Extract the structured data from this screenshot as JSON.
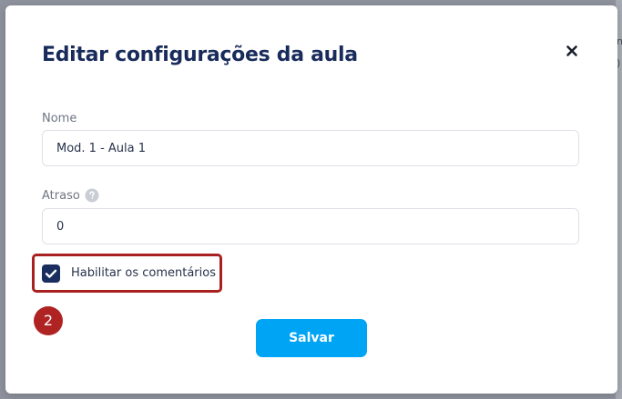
{
  "modal": {
    "title": "Editar configurações da aula",
    "close_icon": "close-icon"
  },
  "fields": {
    "nome": {
      "label": "Nome",
      "value": "Mod. 1 - Aula 1"
    },
    "atraso": {
      "label": "Atraso",
      "value": "0",
      "help_icon": "question-circle-icon"
    }
  },
  "comments": {
    "label": "Habilitar os comentários",
    "checked": true
  },
  "annotation": {
    "step": "2",
    "highlight_color": "#a8201f",
    "badge_color": "#b02323"
  },
  "actions": {
    "save_label": "Salvar"
  },
  "colors": {
    "title": "#182b5b",
    "primary_button": "#00a4f4",
    "checkbox": "#192e5f",
    "backdrop": "#8e929d"
  }
}
